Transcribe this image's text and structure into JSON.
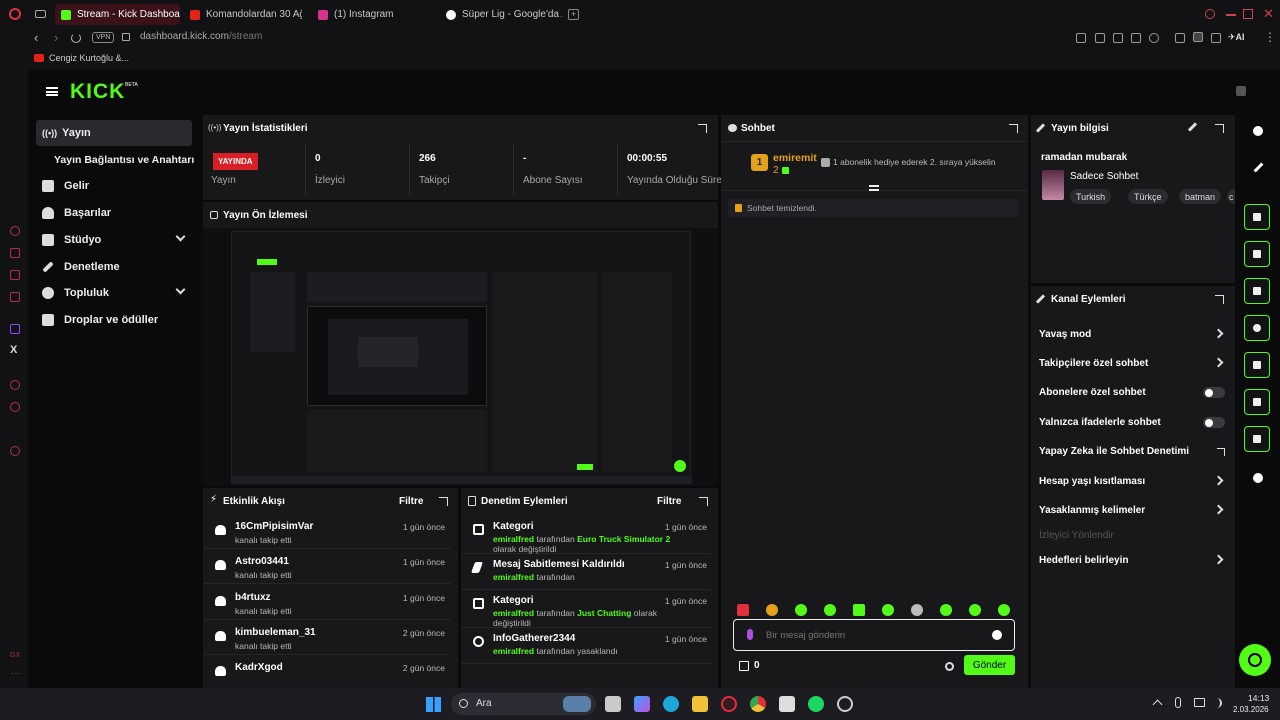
{
  "browser": {
    "tabs": [
      {
        "label": "Stream - Kick Dashboard",
        "active": true
      },
      {
        "label": "Komandolardan 30 Ağustos"
      },
      {
        "label": "(1) Instagram"
      },
      {
        "label": "Süper Lig - Google'da Ara"
      }
    ],
    "vpn_label": "VPN",
    "url_host": "dashboard.kick.com",
    "url_path": "/stream",
    "ai_label": "AI",
    "bookmark": "Cengiz Kurtoğlu &..."
  },
  "app": {
    "logo": "KICK",
    "logo_beta": "BETA",
    "colors": {
      "accent": "#53fc18",
      "live": "#d91f26"
    }
  },
  "sidebar": {
    "items": [
      {
        "label": "Yayın",
        "icon": "broadcast-icon"
      },
      {
        "label": "Yayın Bağlantısı ve Anahtarı"
      },
      {
        "label": "Gelir",
        "icon": "chart-icon"
      },
      {
        "label": "Başarılar",
        "icon": "trophy-icon"
      },
      {
        "label": "Stüdyo",
        "icon": "studio-icon"
      },
      {
        "label": "Denetleme",
        "icon": "wrench-icon"
      },
      {
        "label": "Topluluk",
        "icon": "people-icon"
      },
      {
        "label": "Droplar ve ödüller",
        "icon": "gift-icon"
      }
    ]
  },
  "stats": {
    "title": "Yayın İstatistikleri",
    "live_badge": "YAYINDA",
    "cells": [
      {
        "value": "",
        "label": "Yayın"
      },
      {
        "value": "0",
        "label": "İzleyici"
      },
      {
        "value": "266",
        "label": "Takipçi"
      },
      {
        "value": "-",
        "label": "Abone Sayısı"
      },
      {
        "value": "00:00:55",
        "label": "Yayında Olduğu Süre"
      }
    ]
  },
  "preview": {
    "title": "Yayın Ön İzlemesi"
  },
  "activity": {
    "title": "Etkinlik Akışı",
    "filter": "Filtre",
    "rows": [
      {
        "name": "16CmPipisimVar",
        "sub": "kanalı takip etti",
        "time": "1 gün önce"
      },
      {
        "name": "Astro03441",
        "sub": "kanalı takip etti",
        "time": "1 gün önce"
      },
      {
        "name": "b4rtuxz",
        "sub": "kanalı takip etti",
        "time": "1 gün önce"
      },
      {
        "name": "kimbueleman_31",
        "sub": "kanalı takip etti",
        "time": "2 gün önce"
      },
      {
        "name": "KadrXgod",
        "sub": "",
        "time": "2 gün önce"
      }
    ]
  },
  "moderation": {
    "title": "Denetim Eylemleri",
    "filter": "Filtre",
    "rows": [
      {
        "name": "Kategori",
        "user": "emiralfred",
        "mid": " tarafından ",
        "target": "Euro Truck Simulator 2",
        "end": " olarak değiştirildi",
        "time": "1 gün önce"
      },
      {
        "name": "Mesaj Sabitlemesi Kaldırıldı",
        "user": "emiralfred",
        "mid": " tarafından",
        "target": "",
        "end": "",
        "time": "1 gün önce"
      },
      {
        "name": "Kategori",
        "user": "emiralfred",
        "mid": " tarafından ",
        "target": "Just Chatting",
        "end": " olarak değiştirildi",
        "time": "1 gün önce"
      },
      {
        "name": "InfoGatherer2344",
        "user": "emiralfred",
        "mid": " tarafından yasaklandı",
        "target": "",
        "end": "",
        "time": "1 gün önce"
      }
    ]
  },
  "chat": {
    "title": "Sohbet",
    "pinned_user": "emiremit",
    "pinned_count": "2",
    "pinned_rank": "1",
    "pinned_msg": "1 abonelik hediye ederek 2. sıraya yükselin",
    "system_msg": "Sohbet temizlendi.",
    "input_placeholder": "Bir mesaj gönderin",
    "points": "0",
    "send": "Gönder"
  },
  "stream_info": {
    "title": "Yayın bilgisi",
    "stream_title": "ramadan mubarak",
    "category": "Sadece Sohbet",
    "tags": [
      "Turkish",
      "Türkçe",
      "batman",
      "c"
    ]
  },
  "channel_actions": {
    "title": "Kanal Eylemleri",
    "rows": [
      {
        "label": "Yavaş mod",
        "control": "chevron"
      },
      {
        "label": "Takipçilere özel sohbet",
        "control": "chevron"
      },
      {
        "label": "Abonelere özel sohbet",
        "control": "toggle"
      },
      {
        "label": "Yalnızca ifadelerle sohbet",
        "control": "toggle"
      },
      {
        "label": "Yapay Zeka ile Sohbet Denetimi",
        "control": "external"
      },
      {
        "label": "Hesap yaşı kısıtlaması",
        "control": "chevron"
      },
      {
        "label": "Yasaklanmış kelimeler",
        "control": "chevron"
      },
      {
        "label": "İzleyici Yönlendir",
        "control": "disabled"
      },
      {
        "label": "Hedefleri belirleyin",
        "control": "chevron"
      }
    ]
  },
  "taskbar": {
    "search": "Ara",
    "time": "14:13",
    "date": "2.03.2026"
  }
}
